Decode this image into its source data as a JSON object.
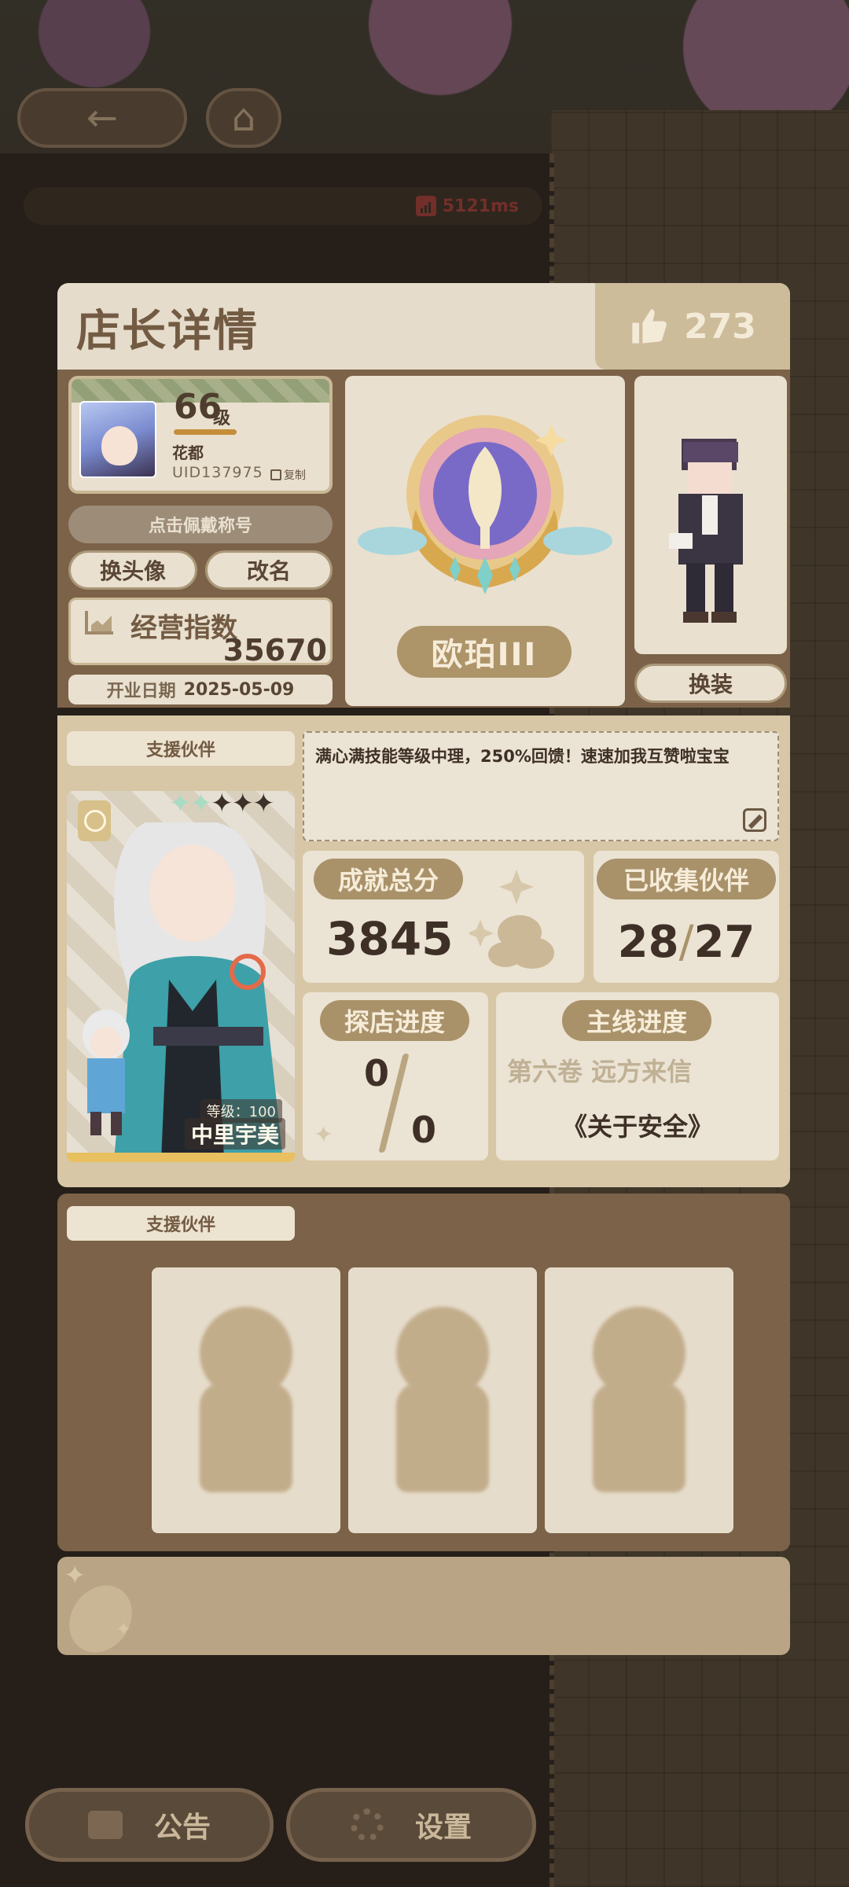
{
  "top": {
    "ping": "5121ms"
  },
  "card": {
    "title": "店长详情",
    "likes": "273",
    "profile": {
      "level": "66",
      "level_unit": "级",
      "nickname": "花都",
      "uid": "UID137975",
      "copy_label": "复制",
      "title_button": "点击佩戴称号",
      "change_avatar": "换头像",
      "rename": "改名",
      "index_label": "经营指数",
      "index_value": "35670",
      "open_date_label": "开业日期",
      "open_date": "2025-05-09"
    },
    "rank": "欧珀III",
    "outfit_button": "换装",
    "support_label": "支援伙伴",
    "partner": {
      "level_text": "等级：100",
      "name": "中里宇美",
      "stars_lit": 2,
      "stars_total": 5
    },
    "signature": "满心满技能等级中理，250%回馈！速速加我互赞啦宝宝",
    "achievement": {
      "label": "成就总分",
      "value": "3845"
    },
    "collected": {
      "label": "已收集伙伴",
      "value_a": "28",
      "value_b": "27"
    },
    "explore": {
      "label": "探店进度",
      "value_a": "0",
      "value_b": "0"
    },
    "mainline": {
      "label": "主线进度",
      "chapter": "第六卷 远方来信",
      "section": "《关于安全》"
    },
    "support_label_2": "支援伙伴"
  },
  "bottom": {
    "notice": "公告",
    "settings": "设置"
  },
  "colors": {
    "accent": "#a9926a",
    "panel": "#e9e0cf",
    "dark": "#7b6248",
    "ping_red": "#8b3a34"
  }
}
